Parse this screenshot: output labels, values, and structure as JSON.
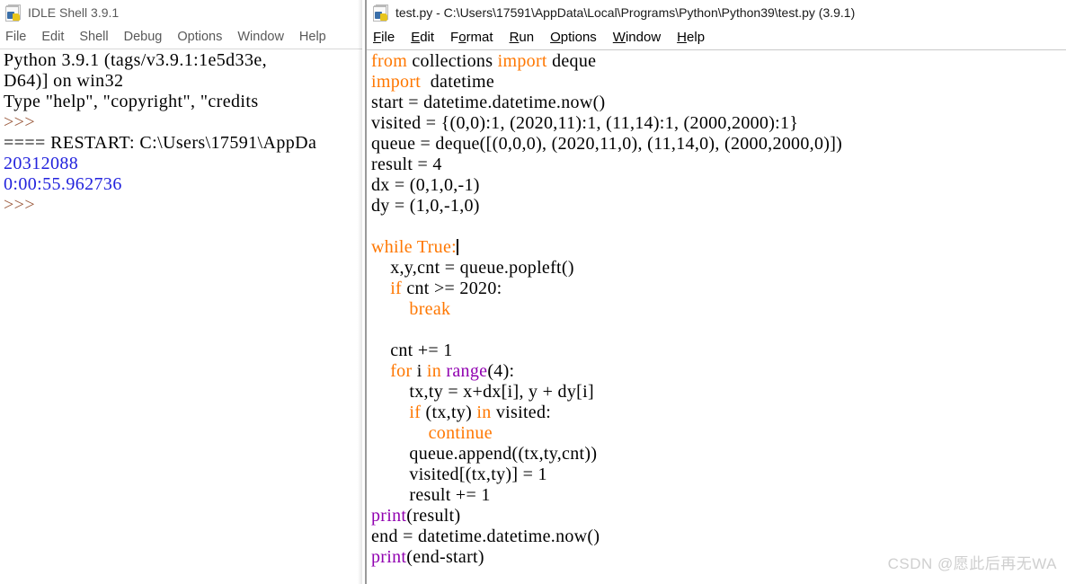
{
  "shell": {
    "icon": "python-file-icon",
    "title": "IDLE Shell 3.9.1",
    "menu": [
      "File",
      "Edit",
      "Shell",
      "Debug",
      "Options",
      "Window",
      "Help"
    ],
    "lines": [
      {
        "kind": "plain",
        "text": "Python 3.9.1 (tags/v3.9.1:1e5d33e,"
      },
      {
        "kind": "plain",
        "text": "D64)] on win32"
      },
      {
        "kind": "plain",
        "text": "Type \"help\", \"copyright\", \"credits"
      },
      {
        "kind": "prompt",
        "text": ">>>"
      },
      {
        "kind": "restart",
        "text": "==== RESTART: C:\\Users\\17591\\AppDa"
      },
      {
        "kind": "output",
        "text": "20312088"
      },
      {
        "kind": "output",
        "text": "0:00:55.962736"
      },
      {
        "kind": "prompt",
        "text": ">>>"
      }
    ]
  },
  "editor": {
    "icon": "python-file-icon",
    "title": "test.py - C:\\Users\\17591\\AppData\\Local\\Programs\\Python\\Python39\\test.py (3.9.1)",
    "menu": [
      {
        "label": "File",
        "accel": "F"
      },
      {
        "label": "Edit",
        "accel": "E"
      },
      {
        "label": "Format",
        "accel": "o"
      },
      {
        "label": "Run",
        "accel": "R"
      },
      {
        "label": "Options",
        "accel": "O"
      },
      {
        "label": "Window",
        "accel": "W"
      },
      {
        "label": "Help",
        "accel": "H"
      }
    ],
    "code_lines": [
      [
        {
          "t": "from",
          "c": "kw"
        },
        {
          "t": " collections ",
          "c": "pl"
        },
        {
          "t": "import",
          "c": "kw"
        },
        {
          "t": " deque",
          "c": "pl"
        }
      ],
      [
        {
          "t": "import",
          "c": "kw"
        },
        {
          "t": "  datetime",
          "c": "pl"
        }
      ],
      [
        {
          "t": "start = datetime.datetime.now()",
          "c": "pl"
        }
      ],
      [
        {
          "t": "visited = {(0,0):1, (2020,11):1, (11,14):1, (2000,2000):1}",
          "c": "pl"
        }
      ],
      [
        {
          "t": "queue = deque([(0,0,0), (2020,11,0), (11,14,0), (2000,2000,0)])",
          "c": "pl"
        }
      ],
      [
        {
          "t": "result = 4",
          "c": "pl"
        }
      ],
      [
        {
          "t": "dx = (0,1,0,-1)",
          "c": "pl"
        }
      ],
      [
        {
          "t": "dy = (1,0,-1,0)",
          "c": "pl"
        }
      ],
      [
        {
          "t": "",
          "c": "pl"
        }
      ],
      [
        {
          "t": "while",
          "c": "kw"
        },
        {
          "t": " ",
          "c": "pl"
        },
        {
          "t": "True",
          "c": "kw"
        },
        {
          "t": ":",
          "c": "kw"
        },
        {
          "t": "",
          "c": "caret"
        }
      ],
      [
        {
          "t": "    x,y,cnt = queue.popleft()",
          "c": "pl"
        }
      ],
      [
        {
          "t": "    ",
          "c": "pl"
        },
        {
          "t": "if",
          "c": "kw"
        },
        {
          "t": " cnt >= 2020:",
          "c": "pl"
        }
      ],
      [
        {
          "t": "        ",
          "c": "pl"
        },
        {
          "t": "break",
          "c": "kw"
        }
      ],
      [
        {
          "t": "",
          "c": "pl"
        }
      ],
      [
        {
          "t": "    cnt += 1",
          "c": "pl"
        }
      ],
      [
        {
          "t": "    ",
          "c": "pl"
        },
        {
          "t": "for",
          "c": "kw"
        },
        {
          "t": " i ",
          "c": "pl"
        },
        {
          "t": "in",
          "c": "kw"
        },
        {
          "t": " ",
          "c": "pl"
        },
        {
          "t": "range",
          "c": "bi"
        },
        {
          "t": "(4):",
          "c": "pl"
        }
      ],
      [
        {
          "t": "        tx,ty = x+dx[i], y + dy[i]",
          "c": "pl"
        }
      ],
      [
        {
          "t": "        ",
          "c": "pl"
        },
        {
          "t": "if",
          "c": "kw"
        },
        {
          "t": " (tx,ty) ",
          "c": "pl"
        },
        {
          "t": "in",
          "c": "kw"
        },
        {
          "t": " visited:",
          "c": "pl"
        }
      ],
      [
        {
          "t": "            ",
          "c": "pl"
        },
        {
          "t": "continue",
          "c": "kw"
        }
      ],
      [
        {
          "t": "        queue.append((tx,ty,cnt))",
          "c": "pl"
        }
      ],
      [
        {
          "t": "        visited[(tx,ty)] = 1",
          "c": "pl"
        }
      ],
      [
        {
          "t": "        result += 1",
          "c": "pl"
        }
      ],
      [
        {
          "t": "print",
          "c": "bi"
        },
        {
          "t": "(result)",
          "c": "pl"
        }
      ],
      [
        {
          "t": "end = datetime.datetime.now()",
          "c": "pl"
        }
      ],
      [
        {
          "t": "print",
          "c": "bi"
        },
        {
          "t": "(end-start)",
          "c": "pl"
        }
      ]
    ]
  },
  "watermark": {
    "text": "CSDN @愿此后再无WA"
  },
  "colors": {
    "keyword": "#ff7700",
    "builtin": "#9000b0",
    "plain": "#000000",
    "shell_output": "#2222dd",
    "shell_prompt": "#9b5a3c",
    "watermark": "#cfcfcf",
    "background": "#ffffff"
  }
}
